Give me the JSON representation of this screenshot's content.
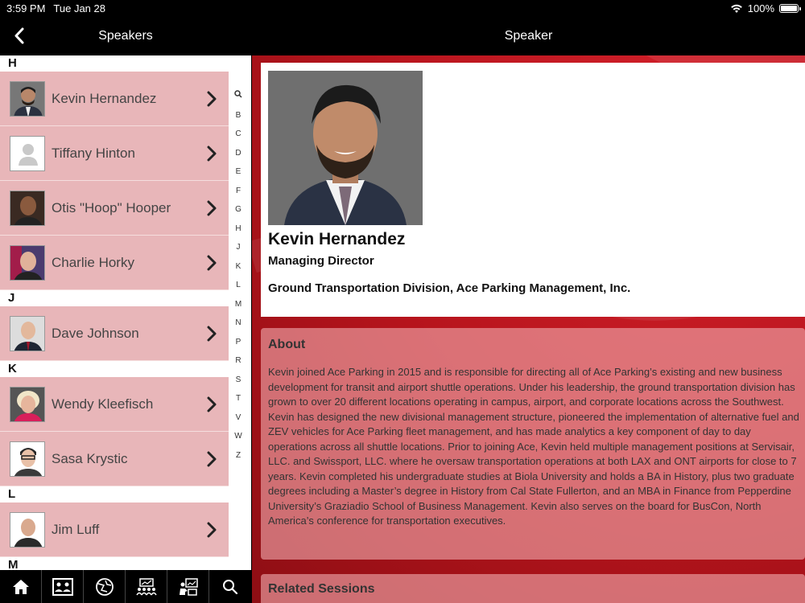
{
  "status_bar": {
    "time": "3:59 PM",
    "date": "Tue Jan 28",
    "battery": "100%"
  },
  "left_nav": {
    "title": "Speakers"
  },
  "sections": [
    {
      "letter": "H",
      "speakers": [
        {
          "name": "Kevin Hernandez",
          "avatar": "photo"
        },
        {
          "name": "Tiffany Hinton",
          "avatar": "placeholder"
        },
        {
          "name": "Otis \"Hoop\" Hooper",
          "avatar": "photo"
        },
        {
          "name": "Charlie Horky",
          "avatar": "photo"
        }
      ]
    },
    {
      "letter": "J",
      "speakers": [
        {
          "name": "Dave Johnson",
          "avatar": "photo"
        }
      ]
    },
    {
      "letter": "K",
      "speakers": [
        {
          "name": "Wendy Kleefisch",
          "avatar": "photo"
        },
        {
          "name": "Sasa Krystic",
          "avatar": "photo"
        }
      ]
    },
    {
      "letter": "L",
      "speakers": [
        {
          "name": "Jim Luff",
          "avatar": "photo"
        }
      ]
    },
    {
      "letter": "M",
      "speakers": []
    }
  ],
  "index_letters": [
    "B",
    "C",
    "D",
    "E",
    "F",
    "G",
    "H",
    "J",
    "K",
    "L",
    "M",
    "N",
    "P",
    "R",
    "S",
    "T",
    "V",
    "W",
    "Z"
  ],
  "tab_bar": {
    "icons": [
      "home-icon",
      "speakers-icon",
      "map-icon",
      "attendees-icon",
      "presentation-icon",
      "search-icon"
    ]
  },
  "right_nav": {
    "title": "Speaker"
  },
  "profile": {
    "name": "Kevin Hernandez",
    "title": "Managing Director",
    "organization": "Ground Transportation Division, Ace Parking Management, Inc."
  },
  "about": {
    "heading": "About",
    "text": "Kevin joined Ace Parking in 2015 and is responsible for directing all of Ace Parking’s existing and new business development for transit and airport shuttle operations. Under his leadership, the ground transportation division has grown to over 20 different locations operating in campus, airport, and corporate locations across the Southwest. Kevin has designed the new divisional management structure, pioneered the implementation of alternative fuel and ZEV vehicles for Ace Parking fleet management, and has made analytics a key component of day to day operations across all shuttle locations. Prior to joining Ace, Kevin held multiple management positions at Servisair, LLC. and Swissport, LLC. where he oversaw transportation operations at both LAX and ONT airports for close to 7 years.  Kevin completed his undergraduate studies at Biola University and holds a BA in History, plus two graduate degrees including a Master’s degree in History from Cal State Fullerton, and an MBA in Finance from Pepperdine University’s Graziadio School of Business Management.  Kevin also serves on the board for BusCon, North America’s conference for transportation executives."
  },
  "related_sessions": {
    "heading": "Related Sessions"
  },
  "colors": {
    "accent_red": "#c4161e",
    "row_pink": "#e8b6b9",
    "nav_black": "#000000"
  }
}
